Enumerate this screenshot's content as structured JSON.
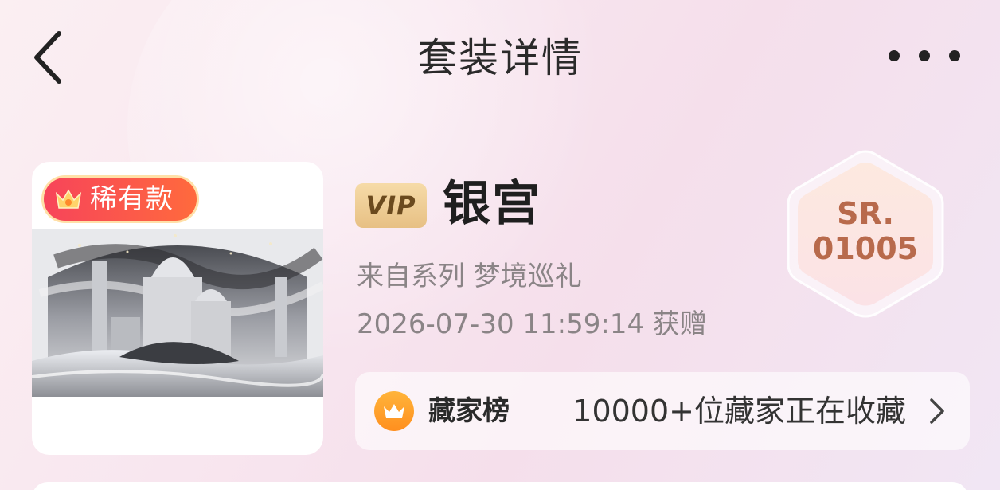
{
  "header": {
    "title": "套装详情",
    "back_icon": "back-arrow-icon",
    "more_icon": "more-icon"
  },
  "card": {
    "rarity_label": "稀有款",
    "rarity_icon": "crown-icon",
    "art_description": "silver-palace-artwork"
  },
  "suit": {
    "vip_label": "VIP",
    "name": "银宫",
    "series_line": "来自系列 梦境巡礼",
    "obtained_line": "2026-07-30 11:59:14 获赠"
  },
  "serial": {
    "prefix": "SR.",
    "number": "01005"
  },
  "collector": {
    "label": "藏家榜",
    "count_text": "10000+位藏家正在收藏",
    "icon": "crown-icon"
  },
  "colors": {
    "accent_badge": "#f7445a",
    "vip_gold": "#e7c084",
    "serial_brown": "#b86a4c",
    "crown_orange": "#ff9a22"
  }
}
